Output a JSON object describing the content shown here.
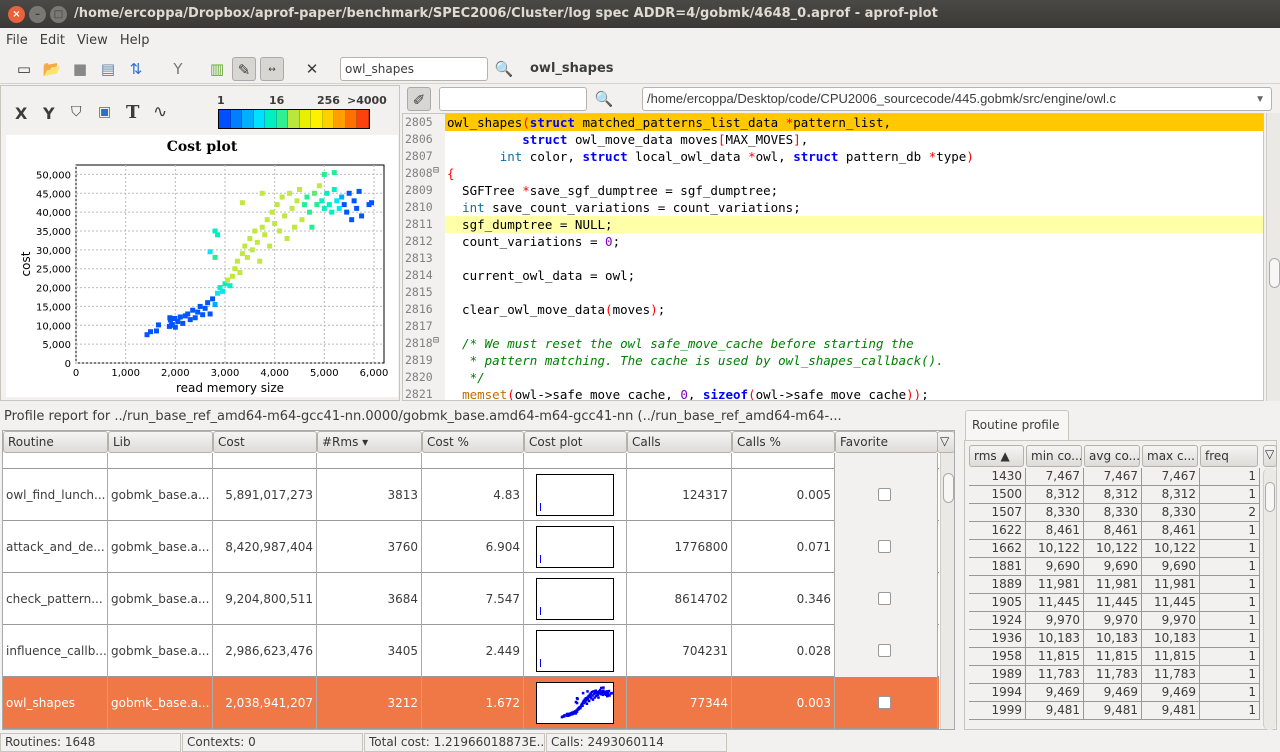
{
  "window": {
    "title": "/home/ercoppa/Dropbox/aprof-paper/benchmark/SPEC2006/Cluster/log spec ADDR=4/gobmk/4648_0.aprof - aprof-plot"
  },
  "menu": [
    "File",
    "Edit",
    "View",
    "Help"
  ],
  "toolbar": {
    "search_value": "owl_shapes",
    "current_routine": "owl_shapes",
    "icons": [
      "new-window-icon",
      "open-folder-icon",
      "save-icon",
      "folder-icon",
      "refresh-icon",
      "merge-icon",
      "bar-chart-icon",
      "notes-icon",
      "compare-icon",
      "tools-icon",
      "search-icon"
    ]
  },
  "plot_panel": {
    "tools": [
      "X",
      "Y",
      "⛉",
      "💾",
      "T",
      "∿"
    ],
    "colorbar": {
      "labels": [
        "1",
        "16",
        "256",
        ">4000"
      ],
      "colors": [
        "#0050ff",
        "#0080ff",
        "#00b0ff",
        "#00e0ff",
        "#00f0c0",
        "#30f090",
        "#b8e840",
        "#e8f000",
        "#fff000",
        "#ffd000",
        "#ffa000",
        "#ff7000",
        "#ff4010"
      ]
    }
  },
  "chart_data": {
    "type": "scatter",
    "title": "Cost plot",
    "xlabel": "read memory size",
    "ylabel": "cost",
    "xlim": [
      0,
      6000
    ],
    "ylim": [
      0,
      52500
    ],
    "grid": true,
    "xticks": [
      "0",
      "1,000",
      "2,000",
      "3,000",
      "4,000",
      "5,000",
      "6,000"
    ],
    "yticks": [
      "0",
      "5,000",
      "10,000",
      "15,000",
      "20,000",
      "25,000",
      "30,000",
      "35,000",
      "40,000",
      "45,000",
      "50,000"
    ],
    "points": [
      [
        1430,
        7500,
        0
      ],
      [
        1500,
        8300,
        0
      ],
      [
        1620,
        8500,
        0
      ],
      [
        1660,
        10100,
        0
      ],
      [
        1880,
        9700,
        0
      ],
      [
        1890,
        12000,
        0
      ],
      [
        1900,
        11400,
        0
      ],
      [
        1920,
        10000,
        0
      ],
      [
        1940,
        10200,
        0
      ],
      [
        1960,
        11800,
        0
      ],
      [
        1990,
        11800,
        0
      ],
      [
        2000,
        9500,
        0
      ],
      [
        2050,
        11000,
        0
      ],
      [
        2100,
        12200,
        0
      ],
      [
        2150,
        10500,
        0
      ],
      [
        2200,
        12500,
        0
      ],
      [
        2250,
        13000,
        0
      ],
      [
        2300,
        11500,
        0
      ],
      [
        2350,
        14000,
        0
      ],
      [
        2400,
        12000,
        0
      ],
      [
        2450,
        13500,
        0
      ],
      [
        2500,
        15000,
        0
      ],
      [
        2550,
        12800,
        0
      ],
      [
        2600,
        14500,
        0
      ],
      [
        2650,
        16000,
        0
      ],
      [
        2700,
        13000,
        0
      ],
      [
        2750,
        17000,
        0
      ],
      [
        2800,
        15500,
        1
      ],
      [
        2850,
        18500,
        2
      ],
      [
        2900,
        20000,
        3
      ],
      [
        2950,
        19000,
        2
      ],
      [
        3000,
        21000,
        3
      ],
      [
        3050,
        22000,
        6
      ],
      [
        3100,
        20500,
        3
      ],
      [
        3150,
        23000,
        6
      ],
      [
        3200,
        25000,
        6
      ],
      [
        3250,
        27000,
        6
      ],
      [
        3300,
        24000,
        6
      ],
      [
        3350,
        29000,
        6
      ],
      [
        3400,
        31000,
        6
      ],
      [
        3450,
        28000,
        6
      ],
      [
        3500,
        33000,
        6
      ],
      [
        3550,
        30000,
        6
      ],
      [
        3600,
        35000,
        6
      ],
      [
        3650,
        32000,
        6
      ],
      [
        3700,
        27000,
        6
      ],
      [
        3750,
        36000,
        6
      ],
      [
        3800,
        34000,
        6
      ],
      [
        3850,
        38000,
        6
      ],
      [
        3900,
        31000,
        6
      ],
      [
        3950,
        40000,
        6
      ],
      [
        4000,
        37000,
        6
      ],
      [
        4050,
        42000,
        6
      ],
      [
        4100,
        35000,
        6
      ],
      [
        4150,
        44000,
        6
      ],
      [
        4200,
        39000,
        6
      ],
      [
        4250,
        33000,
        6
      ],
      [
        4300,
        45000,
        6
      ],
      [
        4350,
        41000,
        6
      ],
      [
        4400,
        36000,
        6
      ],
      [
        4450,
        43000,
        6
      ],
      [
        4500,
        46000,
        6
      ],
      [
        4550,
        38000,
        6
      ],
      [
        4600,
        42000,
        4
      ],
      [
        4650,
        44000,
        4
      ],
      [
        4700,
        40000,
        4
      ],
      [
        4750,
        36000,
        4
      ],
      [
        4800,
        45000,
        5
      ],
      [
        4850,
        42000,
        4
      ],
      [
        4900,
        47000,
        6
      ],
      [
        4950,
        43000,
        3
      ],
      [
        5000,
        41000,
        3
      ],
      [
        5000,
        50000,
        4
      ],
      [
        5050,
        45000,
        3
      ],
      [
        5100,
        42000,
        3
      ],
      [
        5150,
        40000,
        3
      ],
      [
        5200,
        46000,
        3
      ],
      [
        5200,
        50500,
        4
      ],
      [
        5250,
        43000,
        2
      ],
      [
        5300,
        41000,
        2
      ],
      [
        5350,
        44000,
        1
      ],
      [
        5400,
        42000,
        0
      ],
      [
        5450,
        40000,
        0
      ],
      [
        5500,
        45000,
        0
      ],
      [
        5550,
        38000,
        0
      ],
      [
        5600,
        43000,
        0
      ],
      [
        5650,
        41000,
        0
      ],
      [
        5700,
        45500,
        0
      ],
      [
        5750,
        39000,
        0
      ],
      [
        5900,
        42000,
        0
      ],
      [
        5950,
        42500,
        0
      ],
      [
        2800,
        35000,
        3
      ],
      [
        2850,
        34000,
        3
      ],
      [
        2700,
        29500,
        2
      ],
      [
        2800,
        28000,
        4
      ],
      [
        3350,
        42500,
        6
      ],
      [
        3750,
        45000,
        6
      ]
    ]
  },
  "code": {
    "search_value": "",
    "file_path": "/home/ercoppa/Desktop/code/CPU2006_sourcecode/445.gobmk/src/engine/owl.c",
    "lines": [
      {
        "n": "2805",
        "hl": "current",
        "t": [
          [
            "owl_shapes",
            "plain"
          ],
          [
            "(",
            "op"
          ],
          [
            "struct",
            "kw"
          ],
          [
            " matched_patterns_list_data ",
            "plain"
          ],
          [
            "*",
            "op"
          ],
          [
            "pattern_list,",
            "plain"
          ]
        ]
      },
      {
        "n": "2806",
        "t": [
          [
            "          ",
            "plain"
          ],
          [
            "struct",
            "kw"
          ],
          [
            " owl_move_data moves",
            "plain"
          ],
          [
            "[",
            "op"
          ],
          [
            "MAX_MOVES",
            "plain"
          ],
          [
            "]",
            "op"
          ],
          [
            ",",
            "plain"
          ]
        ]
      },
      {
        "n": "2807",
        "t": [
          [
            "       ",
            "plain"
          ],
          [
            "int",
            "ty"
          ],
          [
            " color, ",
            "plain"
          ],
          [
            "struct",
            "kw"
          ],
          [
            " local_owl_data ",
            "plain"
          ],
          [
            "*",
            "op"
          ],
          [
            "owl, ",
            "plain"
          ],
          [
            "struct",
            "kw"
          ],
          [
            " pattern_db ",
            "plain"
          ],
          [
            "*",
            "op"
          ],
          [
            "type",
            "plain"
          ],
          [
            ")",
            "op"
          ]
        ]
      },
      {
        "n": "2808",
        "fold": true,
        "t": [
          [
            "{",
            "op"
          ]
        ]
      },
      {
        "n": "2809",
        "t": [
          [
            "  SGFTree ",
            "plain"
          ],
          [
            "*",
            "op"
          ],
          [
            "save_sgf_dumptree = sgf_dumptree;",
            "plain"
          ]
        ]
      },
      {
        "n": "2810",
        "t": [
          [
            "  ",
            "plain"
          ],
          [
            "int",
            "ty"
          ],
          [
            " save_count_variations = count_variations;",
            "plain"
          ]
        ]
      },
      {
        "n": "2811",
        "hl": "line",
        "t": [
          [
            "  sgf_dumptree = NULL;",
            "plain"
          ]
        ]
      },
      {
        "n": "2812",
        "t": [
          [
            "  count_variations = ",
            "plain"
          ],
          [
            "0",
            "num"
          ],
          [
            ";",
            "plain"
          ]
        ]
      },
      {
        "n": "2813",
        "t": []
      },
      {
        "n": "2814",
        "t": [
          [
            "  current_owl_data = owl;",
            "plain"
          ]
        ]
      },
      {
        "n": "2815",
        "t": []
      },
      {
        "n": "2816",
        "t": [
          [
            "  clear_owl_move_data",
            "plain"
          ],
          [
            "(",
            "op"
          ],
          [
            "moves",
            "plain"
          ],
          [
            ")",
            "op"
          ],
          [
            ";",
            "plain"
          ]
        ]
      },
      {
        "n": "2817",
        "t": []
      },
      {
        "n": "2818",
        "fold": true,
        "t": [
          [
            "  /* We must reset the owl safe_move_cache before starting the",
            "cm"
          ]
        ]
      },
      {
        "n": "2819",
        "t": [
          [
            "   * pattern matching. The cache is used by owl_shapes_callback().",
            "cm"
          ]
        ]
      },
      {
        "n": "2820",
        "t": [
          [
            "   */",
            "cm"
          ]
        ]
      },
      {
        "n": "2821",
        "t": [
          [
            "  ",
            "plain"
          ],
          [
            "memset",
            "fn"
          ],
          [
            "(",
            "op"
          ],
          [
            "owl->safe_move_cache, ",
            "plain"
          ],
          [
            "0",
            "num"
          ],
          [
            ", ",
            "plain"
          ],
          [
            "sizeof",
            "kw"
          ],
          [
            "(",
            "op"
          ],
          [
            "owl->safe_move_cache",
            "plain"
          ],
          [
            "))",
            "op"
          ],
          [
            ";",
            "plain"
          ]
        ]
      }
    ]
  },
  "profile": {
    "label": "Profile report for ../run_base_ref_amd64-m64-gcc41-nn.0000/gobmk_base.amd64-m64-gcc41-nn (../run_base_ref_amd64-m64-...",
    "columns": [
      "Routine",
      "Lib",
      "Cost",
      "#Rms ▾",
      "Cost %",
      "Cost plot",
      "Calls",
      "Calls %",
      "Favorite"
    ],
    "rows": [
      {
        "routine": "owl_find_lunch...",
        "lib": "gobmk_base.a...",
        "cost": "5,891,017,273",
        "rms": "3813",
        "cost_pct": "4.83",
        "calls": "124317",
        "calls_pct": "0.005",
        "favorite": false
      },
      {
        "routine": "attack_and_de...",
        "lib": "gobmk_base.a...",
        "cost": "8,420,987,404",
        "rms": "3760",
        "cost_pct": "6.904",
        "calls": "1776800",
        "calls_pct": "0.071",
        "favorite": false
      },
      {
        "routine": "check_pattern...",
        "lib": "gobmk_base.a...",
        "cost": "9,204,800,511",
        "rms": "3684",
        "cost_pct": "7.547",
        "calls": "8614702",
        "calls_pct": "0.346",
        "favorite": false
      },
      {
        "routine": "influence_callb...",
        "lib": "gobmk_base.a...",
        "cost": "2,986,623,476",
        "rms": "3405",
        "cost_pct": "2.449",
        "calls": "704231",
        "calls_pct": "0.028",
        "favorite": false
      },
      {
        "routine": "owl_shapes",
        "lib": "gobmk_base.a...",
        "cost": "2,038,941,207",
        "rms": "3212",
        "cost_pct": "1.672",
        "calls": "77344",
        "calls_pct": "0.003",
        "favorite": false,
        "selected": true
      }
    ]
  },
  "routine_profile": {
    "tab": "Routine profile",
    "columns": [
      "rms ▲",
      "min co...",
      "avg co...",
      "max c...",
      "freq"
    ],
    "rows": [
      [
        "1430",
        "7,467",
        "7,467",
        "7,467",
        "1"
      ],
      [
        "1500",
        "8,312",
        "8,312",
        "8,312",
        "1"
      ],
      [
        "1507",
        "8,330",
        "8,330",
        "8,330",
        "2"
      ],
      [
        "1622",
        "8,461",
        "8,461",
        "8,461",
        "1"
      ],
      [
        "1662",
        "10,122",
        "10,122",
        "10,122",
        "1"
      ],
      [
        "1881",
        "9,690",
        "9,690",
        "9,690",
        "1"
      ],
      [
        "1889",
        "11,981",
        "11,981",
        "11,981",
        "1"
      ],
      [
        "1905",
        "11,445",
        "11,445",
        "11,445",
        "1"
      ],
      [
        "1924",
        "9,970",
        "9,970",
        "9,970",
        "1"
      ],
      [
        "1936",
        "10,183",
        "10,183",
        "10,183",
        "1"
      ],
      [
        "1958",
        "11,815",
        "11,815",
        "11,815",
        "1"
      ],
      [
        "1989",
        "11,783",
        "11,783",
        "11,783",
        "1"
      ],
      [
        "1994",
        "9,469",
        "9,469",
        "9,469",
        "1"
      ],
      [
        "1999",
        "9,481",
        "9,481",
        "9,481",
        "1"
      ]
    ]
  },
  "status": {
    "routines": "Routines: 1648",
    "contexts": "Contexts: 0",
    "total_cost": "Total cost: 1.21966018873E...",
    "calls": "Calls: 2493060114"
  },
  "colors": {
    "selected_row": "#f07746",
    "current_line": "#ffc800",
    "highlight_line": "#ffffa8"
  }
}
